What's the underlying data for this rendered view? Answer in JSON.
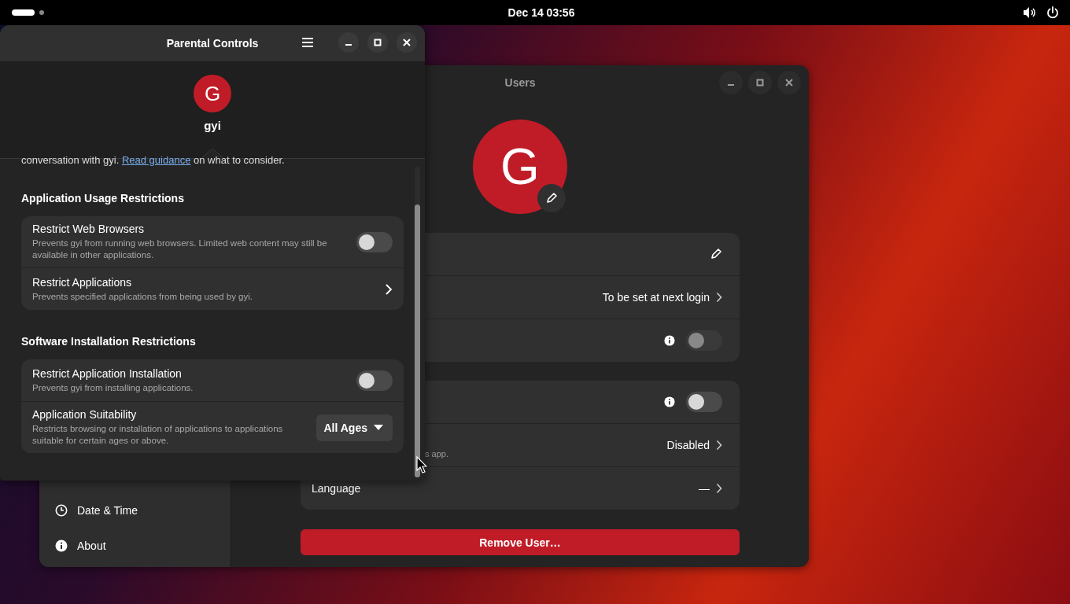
{
  "top_bar": {
    "clock": "Dec 14  03:56"
  },
  "settings_window": {
    "title": "Users",
    "avatar_initial": "G",
    "sidebar": {
      "items": [
        {
          "label": "Date & Time",
          "selected": false
        },
        {
          "label": "About",
          "selected": false
        }
      ]
    },
    "groups": [
      {
        "rows": [
          {
            "kind": "edit"
          },
          {
            "kind": "value",
            "value": "To be set at next login"
          },
          {
            "kind": "toggle",
            "on": false,
            "disabled": true
          }
        ]
      },
      {
        "rows": [
          {
            "kind": "toggle",
            "on": false,
            "disabled": false
          },
          {
            "kind": "value",
            "subtitle": "s app.",
            "value": "Disabled"
          },
          {
            "kind": "value",
            "label": "Language",
            "value": "—"
          }
        ]
      }
    ],
    "remove_button": "Remove User…"
  },
  "parental_window": {
    "title": "Parental Controls",
    "user": {
      "initial": "G",
      "name": "gyi"
    },
    "intro": {
      "text": "conversation with gyi.",
      "link": "Read guidance",
      "rest": "on what to consider."
    },
    "sections": [
      {
        "heading": "Application Usage Restrictions",
        "rows": [
          {
            "kind": "switch",
            "title": "Restrict Web Browsers",
            "subtitle": "Prevents gyi from running web browsers. Limited web content may still be available in other applications.",
            "on": false
          },
          {
            "kind": "link",
            "title": "Restrict Applications",
            "subtitle": "Prevents specified applications from being used by gyi."
          }
        ]
      },
      {
        "heading": "Software Installation Restrictions",
        "rows": [
          {
            "kind": "switch",
            "title": "Restrict Application Installation",
            "subtitle": "Prevents gyi from installing applications.",
            "on": false
          },
          {
            "kind": "dropdown",
            "title": "Application Suitability",
            "subtitle": "Restricts browsing or installation of applications to applications suitable for certain ages or above.",
            "value": "All Ages"
          }
        ]
      }
    ]
  }
}
